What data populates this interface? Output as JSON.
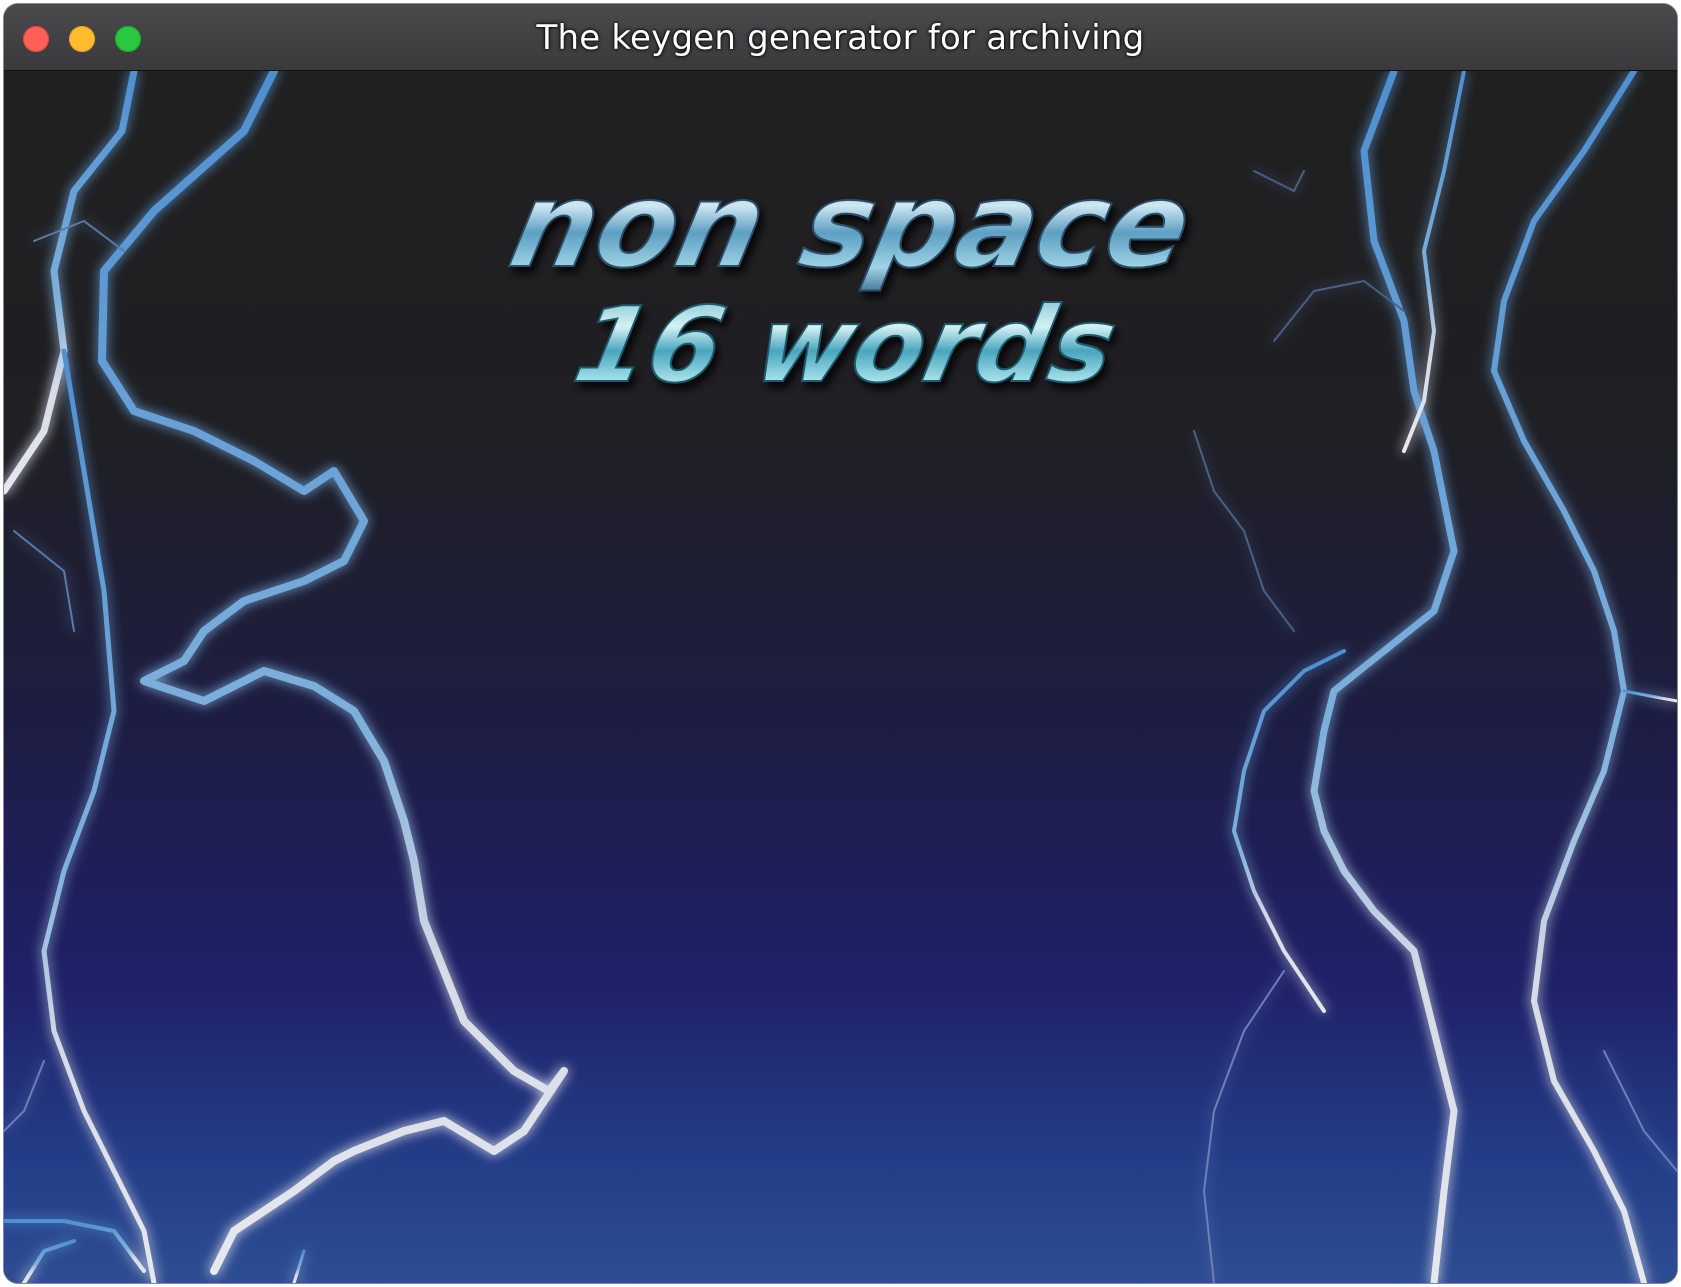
{
  "window": {
    "title": "The keygen generator for archiving"
  },
  "logo": {
    "line1": "non space",
    "line2": "16 words"
  },
  "colors": {
    "lightning_glow": "#4f8fd0",
    "lightning_core": "#d6dbe6",
    "logo_fill": "#7fc4d8",
    "background_top": "#202020",
    "background_bottom": "#2d4d92"
  }
}
